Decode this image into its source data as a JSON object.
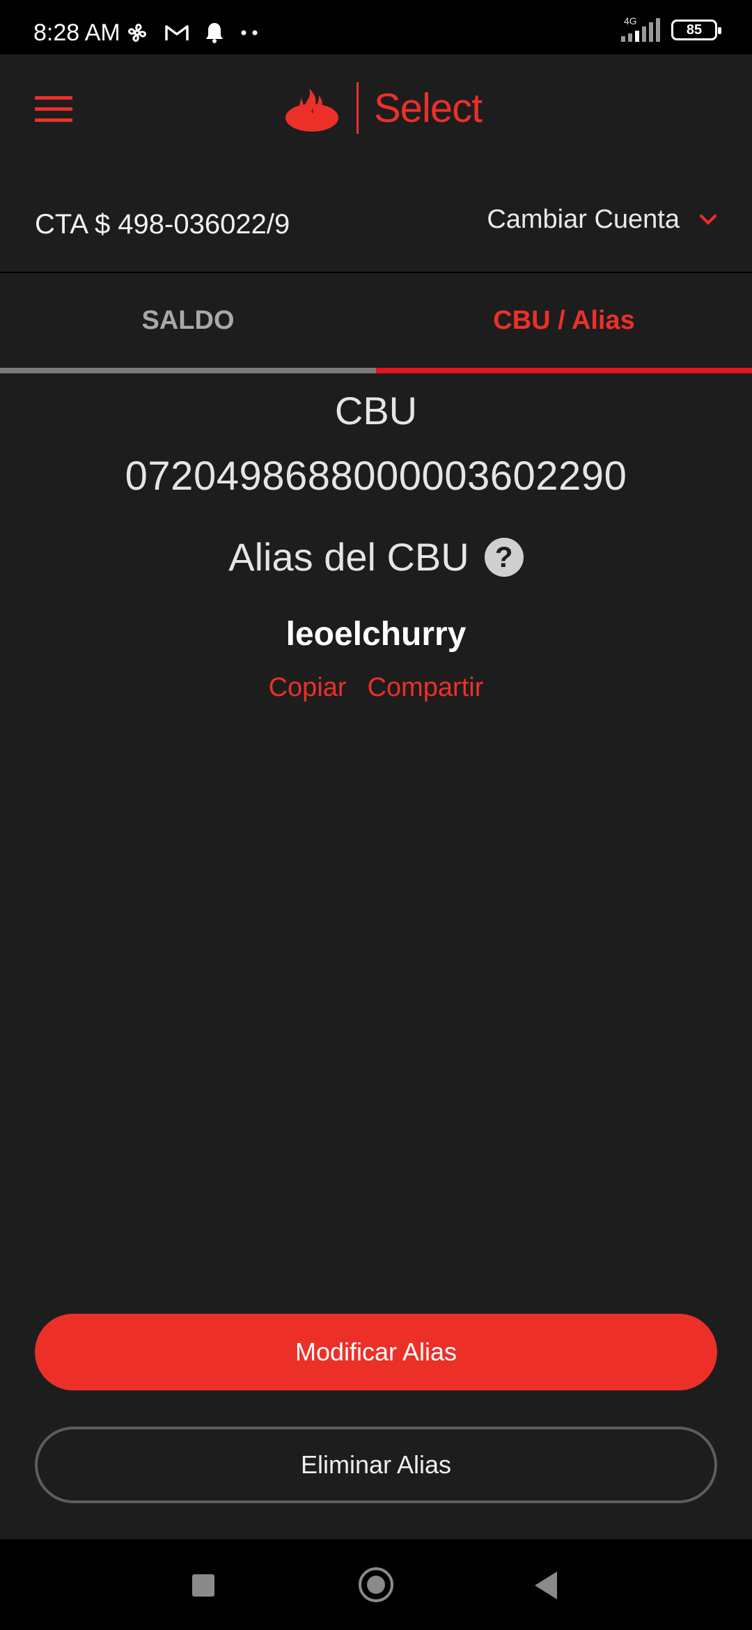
{
  "status_bar": {
    "time": "8:28 AM",
    "network": "4G",
    "battery": "85"
  },
  "header": {
    "brand": "Select"
  },
  "account": {
    "number": "CTA $ 498-036022/9",
    "change_label": "Cambiar Cuenta"
  },
  "tabs": [
    {
      "label": "SALDO",
      "active": false
    },
    {
      "label": "CBU / Alias",
      "active": true
    }
  ],
  "cbu": {
    "title": "CBU",
    "number": "0720498688000003602290",
    "alias_title": "Alias del CBU",
    "help_symbol": "?",
    "alias": "leoelchurry",
    "copy_label": "Copiar",
    "share_label": "Compartir"
  },
  "actions": {
    "modify_label": "Modificar Alias",
    "delete_label": "Eliminar Alias"
  },
  "colors": {
    "accent": "#ec3028",
    "background": "#1d1d1e"
  }
}
